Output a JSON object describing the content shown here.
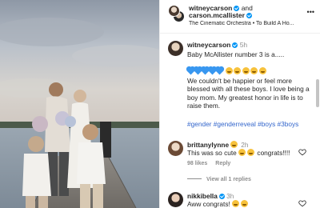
{
  "post": {
    "photo_alt": "photo",
    "header": {
      "user1": "witneycarson",
      "and": "and",
      "user2": "carson.mcallister",
      "music": "The Cinematic Orchestra • To Build A Ho..."
    },
    "caption": {
      "username": "witneycarson",
      "time": "5h",
      "line1": "Baby McAllister number 3 is a.....",
      "body": "We couldn't be happier or feel more blessed with all these boys. I love being a boy mom. My greatest honor in life is to raise them.",
      "hashtags": "#gender #genderreveal #boys #3boys"
    },
    "comments": [
      {
        "username": "brittanylynne",
        "time": "2h",
        "text_start": "This was so cute",
        "text_end": "congrats!!!!",
        "likes": "98 likes",
        "reply": "Reply",
        "view_replies": "View all 1 replies"
      },
      {
        "username": "nikkibella",
        "time": "3h",
        "text_start": "Aww congrats!"
      }
    ]
  },
  "colors": {
    "verified": "#0095f6",
    "hashtag": "#3366cc",
    "meta": "#8e8e8e",
    "heart": "#3897f0"
  }
}
